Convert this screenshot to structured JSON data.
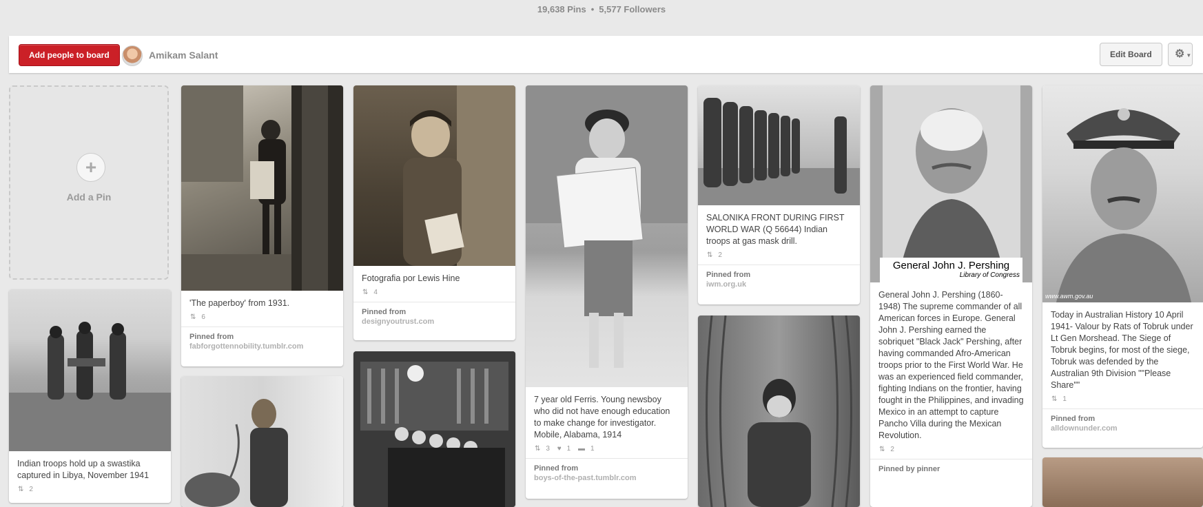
{
  "header": {
    "pins": "19,638 Pins",
    "separator": "•",
    "followers": "5,577 Followers"
  },
  "toolbar": {
    "add_people_label": "Add people to board",
    "owner_name": "Amikam Salant",
    "edit_board_label": "Edit Board",
    "settings_icon": "gear-icon",
    "caret_icon": "chevron-down-icon"
  },
  "add_pin": {
    "label": "Add a Pin",
    "icon": "plus-icon"
  },
  "pins": [
    {
      "description": "Indian troops hold up a swastika captured in Libya, November 1941",
      "repins": "2"
    },
    {
      "description": "'The paperboy' from 1931.",
      "repins": "6",
      "source_label": "Pinned from",
      "source": "fabforgottennobility.tumblr.com"
    },
    {
      "description": "Fotografia por Lewis Hine",
      "repins": "4",
      "source_label": "Pinned from",
      "source": "designyoutrust.com"
    },
    {
      "description": "7 year old Ferris. Young newsboy who did not have enough education to make change for investigator. Mobile, Alabama, 1914",
      "repins": "3",
      "likes": "1",
      "comments": "1",
      "source_label": "Pinned from",
      "source": "boys-of-the-past.tumblr.com"
    },
    {
      "description": "SALONIKA FRONT DURING FIRST WORLD WAR (Q 56644) Indian troops at gas mask drill.",
      "repins": "2",
      "source_label": "Pinned from",
      "source": "iwm.org.uk"
    },
    {
      "description": "General John J. Pershing (1860-1948) The supreme commander of all American forces in Europe. General John J. Pershing earned the sobriquet \"Black Jack\" Pershing, after having commanded Afro-American troops prior to the First World War. He was an experienced field commander, fighting Indians on the frontier, having fought in the Philippines, and invading Mexico in an attempt to capture Pancho Villa during the Mexican Revolution.",
      "repins": "2",
      "source_label": "Pinned by pinner",
      "photo_caption": "General John J. Pershing",
      "photo_credit": "Library of Congress"
    },
    {
      "description": "Today in Australian History 10 April 1941- Valour by Rats of Tobruk under Lt Gen Morshead. The Siege of Tobruk begins, for most of the siege, Tobruk was defended by the Australian 9th Division \"\"Please Share\"\"",
      "repins": "1",
      "source_label": "Pinned from",
      "source": "alldownunder.com",
      "watermark": "www.awm.gov.au"
    }
  ],
  "icons": {
    "repin": "repin-icon",
    "like": "heart-icon",
    "comment": "comment-icon"
  }
}
